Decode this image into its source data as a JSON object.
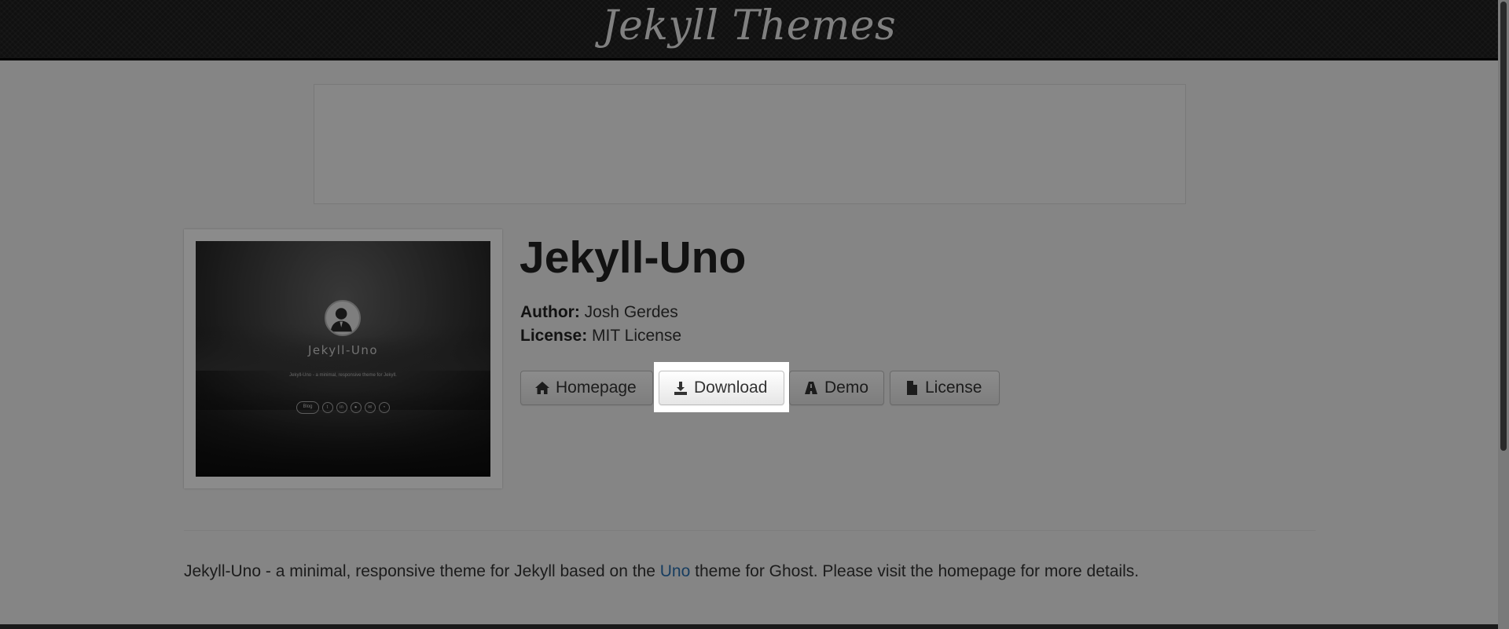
{
  "navbar": {
    "brand": "Jekyll Themes"
  },
  "theme": {
    "title": "Jekyll-Uno",
    "author_label": "Author:",
    "author": "Josh Gerdes",
    "license_label": "License:",
    "license": "MIT License"
  },
  "thumbnail": {
    "title": "Jekyll-Uno",
    "subtitle": "Jekyll-Uno - a minimal, responsive theme for Jekyll.",
    "blog_label": "Blog"
  },
  "buttons": {
    "homepage": "Homepage",
    "download": "Download",
    "demo": "Demo",
    "license": "License"
  },
  "description": {
    "before": "Jekyll-Uno - a minimal, responsive theme for Jekyll based on the ",
    "link": "Uno",
    "after": " theme for Ghost. Please visit the homepage for more details."
  },
  "colors": {
    "navbar_bg": "#1e1e1e",
    "link": "#2a6fb0",
    "overlay": "rgba(0,0,0,0.45)"
  },
  "icons": {
    "homepage": "home-icon",
    "download": "download-icon",
    "demo": "road-icon",
    "license": "file-icon"
  }
}
